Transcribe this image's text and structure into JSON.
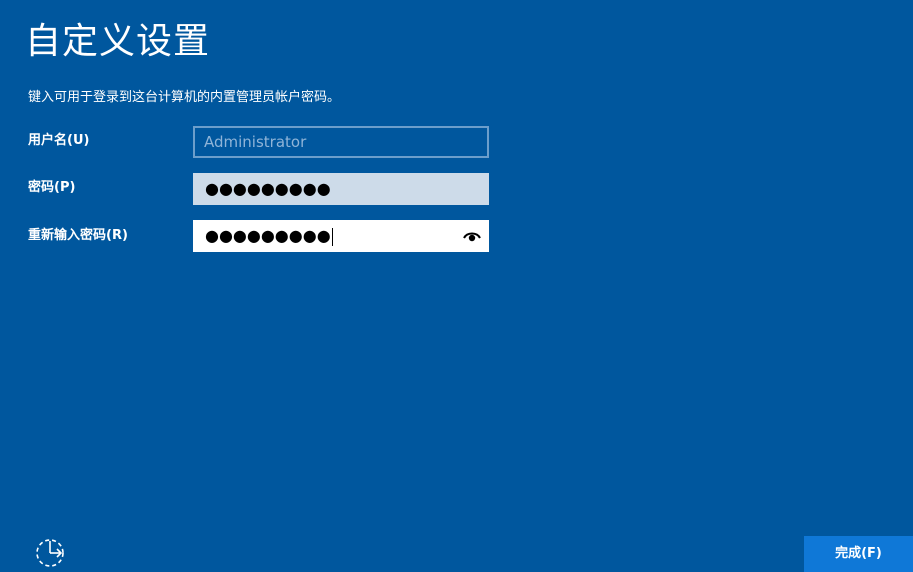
{
  "header": {
    "title": "自定义设置",
    "subtitle": "键入可用于登录到这台计算机的内置管理员帐户密码。"
  },
  "form": {
    "username": {
      "label": "用户名(U)",
      "placeholder": "Administrator"
    },
    "password": {
      "label": "密码(P)",
      "value_mask": "●●●●●●●●●"
    },
    "confirm_password": {
      "label": "重新输入密码(R)",
      "value_mask": "●●●●●●●●●",
      "reveal_icon": "eye-icon"
    }
  },
  "footer": {
    "ease_of_access_icon": "ease-of-access-icon",
    "finish_label": "完成(F)"
  },
  "colors": {
    "background": "#00579e",
    "button": "#0f78d7",
    "field_focus": "#ffffff",
    "field_filled": "#cddbe9",
    "field_border": "#6c9ecb"
  }
}
